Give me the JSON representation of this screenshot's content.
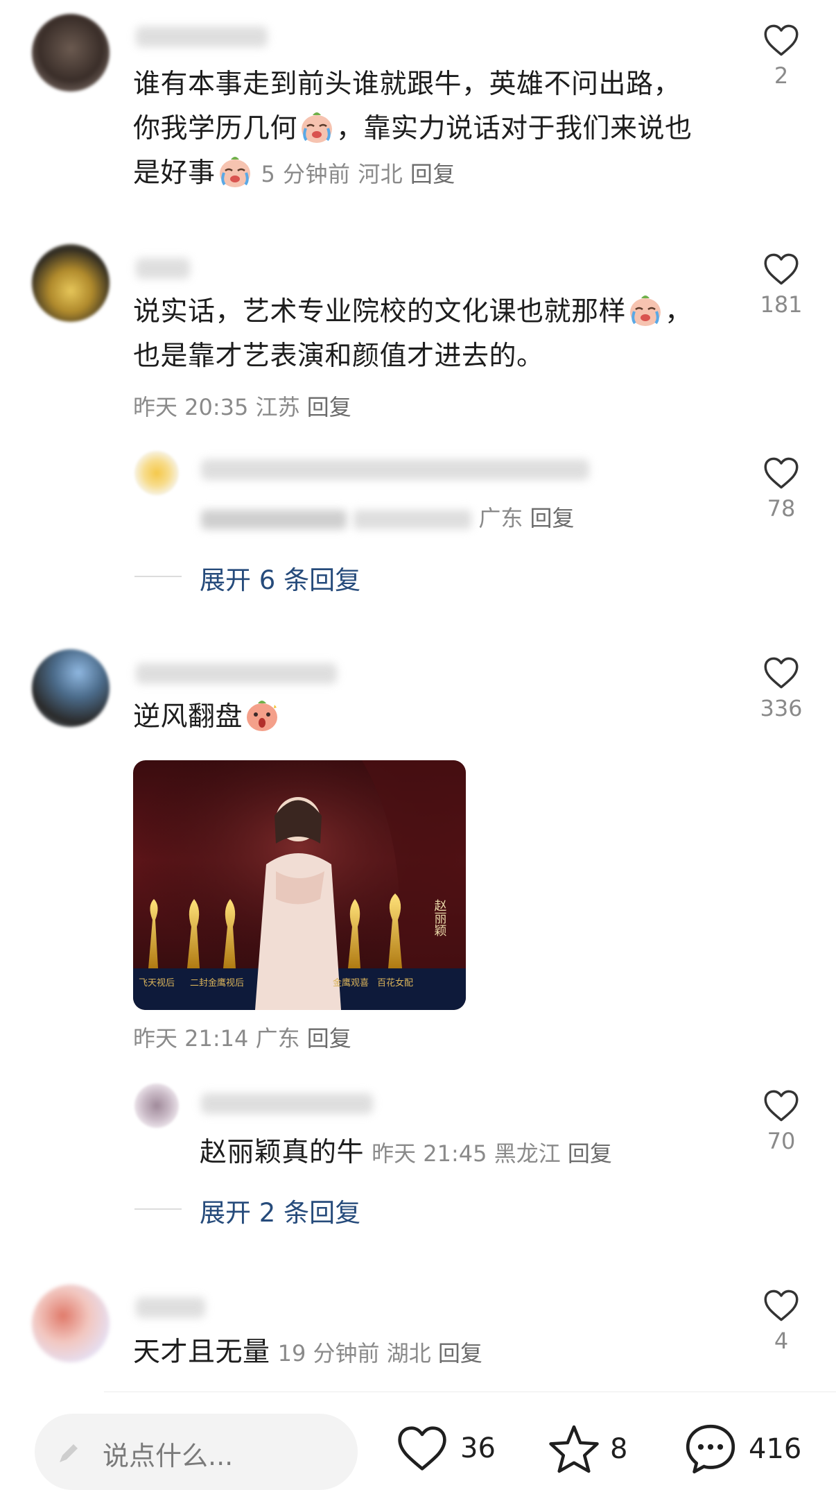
{
  "colors": {
    "link_blue": "#264b7b",
    "meta_gray": "#8a8a8a",
    "text": "#1d1d1d",
    "input_bg": "#f3f3f3"
  },
  "comments": [
    {
      "text_line1": "谁有本事走到前头谁就跟牛，英雄不问出路，",
      "text_line2a": "你我学历几何",
      "text_line2b": "，靠实力说话对于我们来说也",
      "text_line3": "是好事",
      "time": "5 分钟前",
      "region": "河北",
      "reply": "回复",
      "likes": "2"
    },
    {
      "text_line1": "说实话，艺术专业院校的文化课也就那样",
      "text_line1b": "，",
      "text_line2": "也是靠才艺表演和颜值才进去的。",
      "time": "昨天 20:35",
      "region": "江苏",
      "reply": "回复",
      "likes": "181",
      "sub_reply": {
        "region": "广东",
        "reply": "回复",
        "likes": "78"
      },
      "expand": "展开 6 条回复"
    },
    {
      "text": "逆风翻盘",
      "image_caption": {
        "name": "赵丽颖",
        "labels": [
          "飞天视后",
          "二封金鹰视后",
          "金鹰观喜",
          "百花女配"
        ]
      },
      "time": "昨天 21:14",
      "region": "广东",
      "reply": "回复",
      "likes": "336",
      "sub_reply": {
        "text": "赵丽颖真的牛",
        "time": "昨天 21:45",
        "region": "黑龙江",
        "reply": "回复",
        "likes": "70"
      },
      "expand": "展开 2 条回复"
    },
    {
      "text": "天才且无量",
      "time": "19 分钟前",
      "region": "湖北",
      "reply": "回复",
      "likes": "4"
    }
  ],
  "bottom_bar": {
    "input_placeholder": "说点什么...",
    "like_count": "36",
    "star_count": "8",
    "comment_count": "416"
  },
  "icons": {
    "like": "heart-outline-icon",
    "star": "star-outline-icon",
    "comment": "speech-bubble-icon",
    "pen": "pen-icon"
  }
}
